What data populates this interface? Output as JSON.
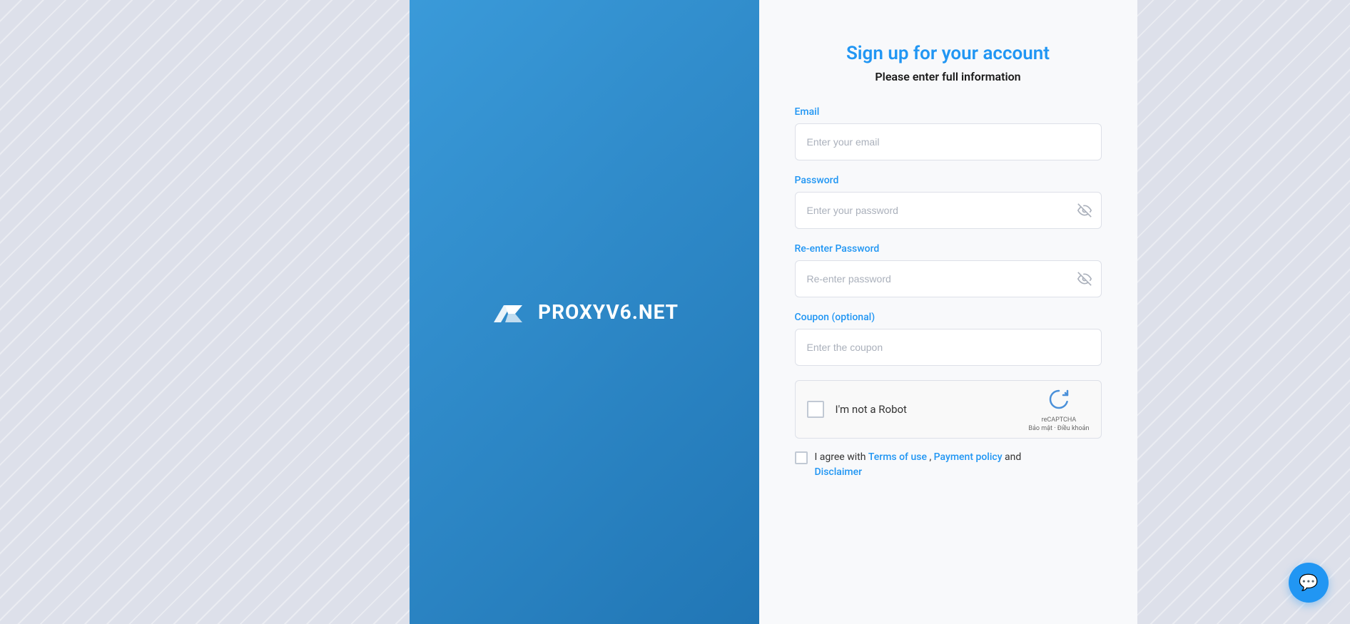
{
  "page": {
    "background_color": "#dde0ea"
  },
  "left_panel": {
    "logo_text": "PROXYV6.NET"
  },
  "form": {
    "title": "Sign up for your account",
    "subtitle": "Please enter full information",
    "email_label": "Email",
    "email_placeholder": "Enter your email",
    "password_label": "Password",
    "password_placeholder": "Enter your password",
    "reenter_label": "Re-enter Password",
    "reenter_placeholder": "Re-enter password",
    "coupon_label": "Coupon (optional)",
    "coupon_placeholder": "Enter the coupon",
    "recaptcha_label": "I'm not a Robot",
    "recaptcha_sub1": "reCAPTCHA",
    "recaptcha_sub2": "Bảo mật · Điều khoản",
    "terms_prefix": "I agree with ",
    "terms_link1": "Terms of use",
    "terms_sep": " , ",
    "terms_link2": "Payment policy",
    "terms_suffix": " and",
    "terms_link3": "Disclaimer"
  },
  "chat": {
    "icon": "💬"
  }
}
